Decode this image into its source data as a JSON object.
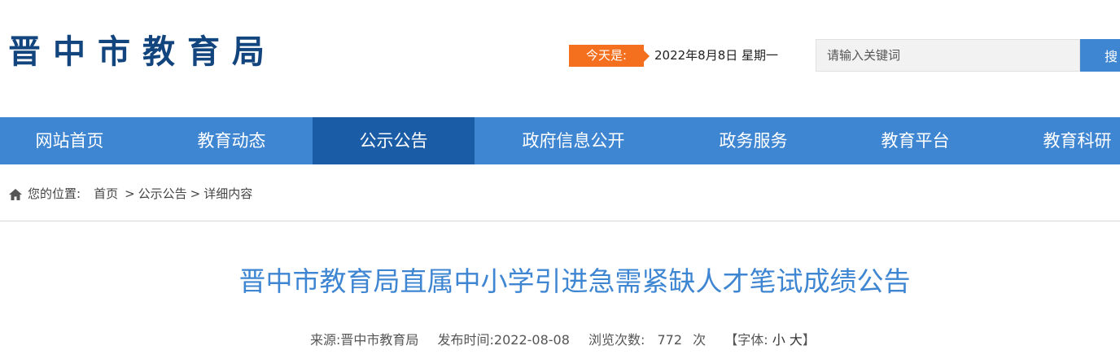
{
  "header": {
    "logo_text": "晋中市教育局",
    "today_label": "今天是:",
    "today_date": "2022年8月8日 星期一",
    "search": {
      "placeholder": "请输入关键词",
      "button_label": "搜"
    }
  },
  "nav": {
    "items": [
      {
        "label": "网站首页"
      },
      {
        "label": "教育动态"
      },
      {
        "label": "公示公告",
        "active": true
      },
      {
        "label": "政府信息公开"
      },
      {
        "label": "政务服务"
      },
      {
        "label": "教育平台"
      },
      {
        "label": "教育科研"
      }
    ]
  },
  "breadcrumb": {
    "prefix": "您的位置:",
    "home": "首页",
    "section": "公示公告",
    "current": "详细内容",
    "separator": ">"
  },
  "article": {
    "title": "晋中市教育局直属中小学引进急需紧缺人才笔试成绩公告",
    "source_label": "来源:",
    "source": "晋中市教育局",
    "publish_label": "发布时间:",
    "publish_date": "2022-08-08",
    "views_label": "浏览次数:",
    "views": "772",
    "views_unit": "次",
    "font_label": "【字体:",
    "font_small": "小",
    "font_large": "大",
    "font_close": "】"
  },
  "colors": {
    "brand_navy": "#12447e",
    "nav_blue": "#3f86d2",
    "nav_active": "#1a5ca6",
    "badge_orange": "#f46f1e"
  },
  "icons": {
    "breadcrumb_home": "home-icon"
  }
}
